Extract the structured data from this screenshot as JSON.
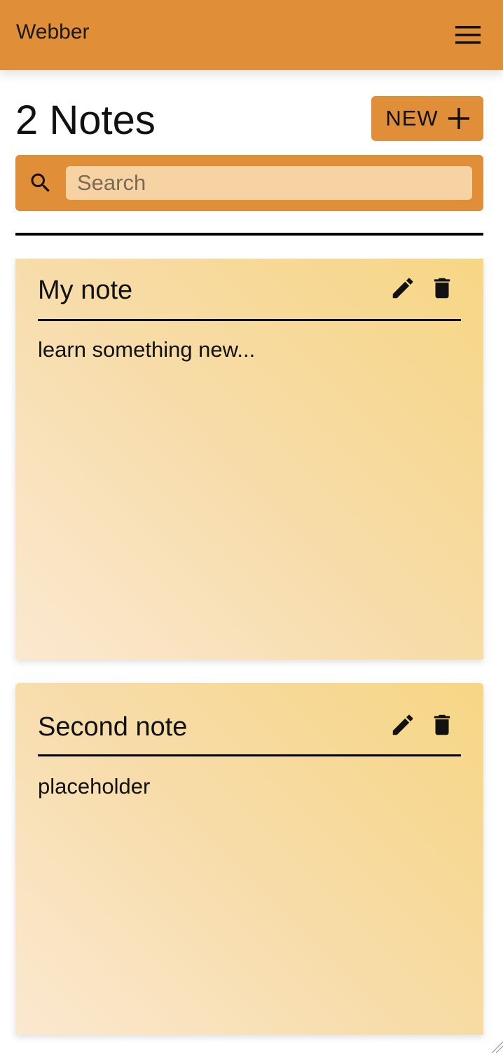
{
  "app_bar": {
    "title": "Webber",
    "menu_icon": "hamburger-menu-icon"
  },
  "header": {
    "notes_count": "2 Notes",
    "new_button_label": "NEW",
    "new_button_icon": "plus-icon"
  },
  "search": {
    "placeholder": "Search",
    "value": "",
    "icon": "search-icon"
  },
  "notes": [
    {
      "title": "My note",
      "body": "learn something new...",
      "edit_icon": "pencil-icon",
      "delete_icon": "trash-icon"
    },
    {
      "title": "Second note",
      "body": "placeholder",
      "edit_icon": "pencil-icon",
      "delete_icon": "trash-icon"
    }
  ],
  "colors": {
    "accent": "#e08e37",
    "search_field": "#f7d3a4",
    "note_gradient_start": "#fbe8d0",
    "note_gradient_end": "#f7d685"
  }
}
